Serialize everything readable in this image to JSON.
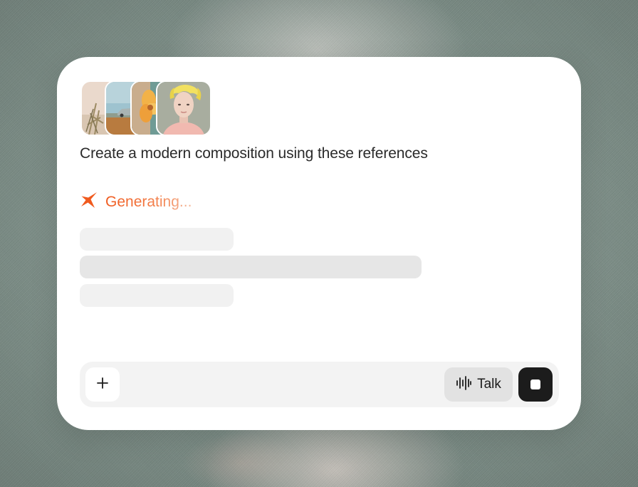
{
  "composer": {
    "prompt_text": "Create a modern composition using these references",
    "status_text": "Generating...",
    "talk_label": "Talk"
  },
  "references": [
    {
      "name": "dry-grass-reference"
    },
    {
      "name": "car-landscape-reference"
    },
    {
      "name": "flower-reference"
    },
    {
      "name": "portrait-reference"
    }
  ],
  "icons": {
    "status": "sparkle-icon",
    "add": "plus-icon",
    "talk": "waveform-icon",
    "stop": "stop-icon"
  },
  "colors": {
    "accent": "#f05a1e",
    "stop_button": "#1c1c1c",
    "card_background": "#ffffff",
    "composer_background": "#f3f3f3"
  }
}
